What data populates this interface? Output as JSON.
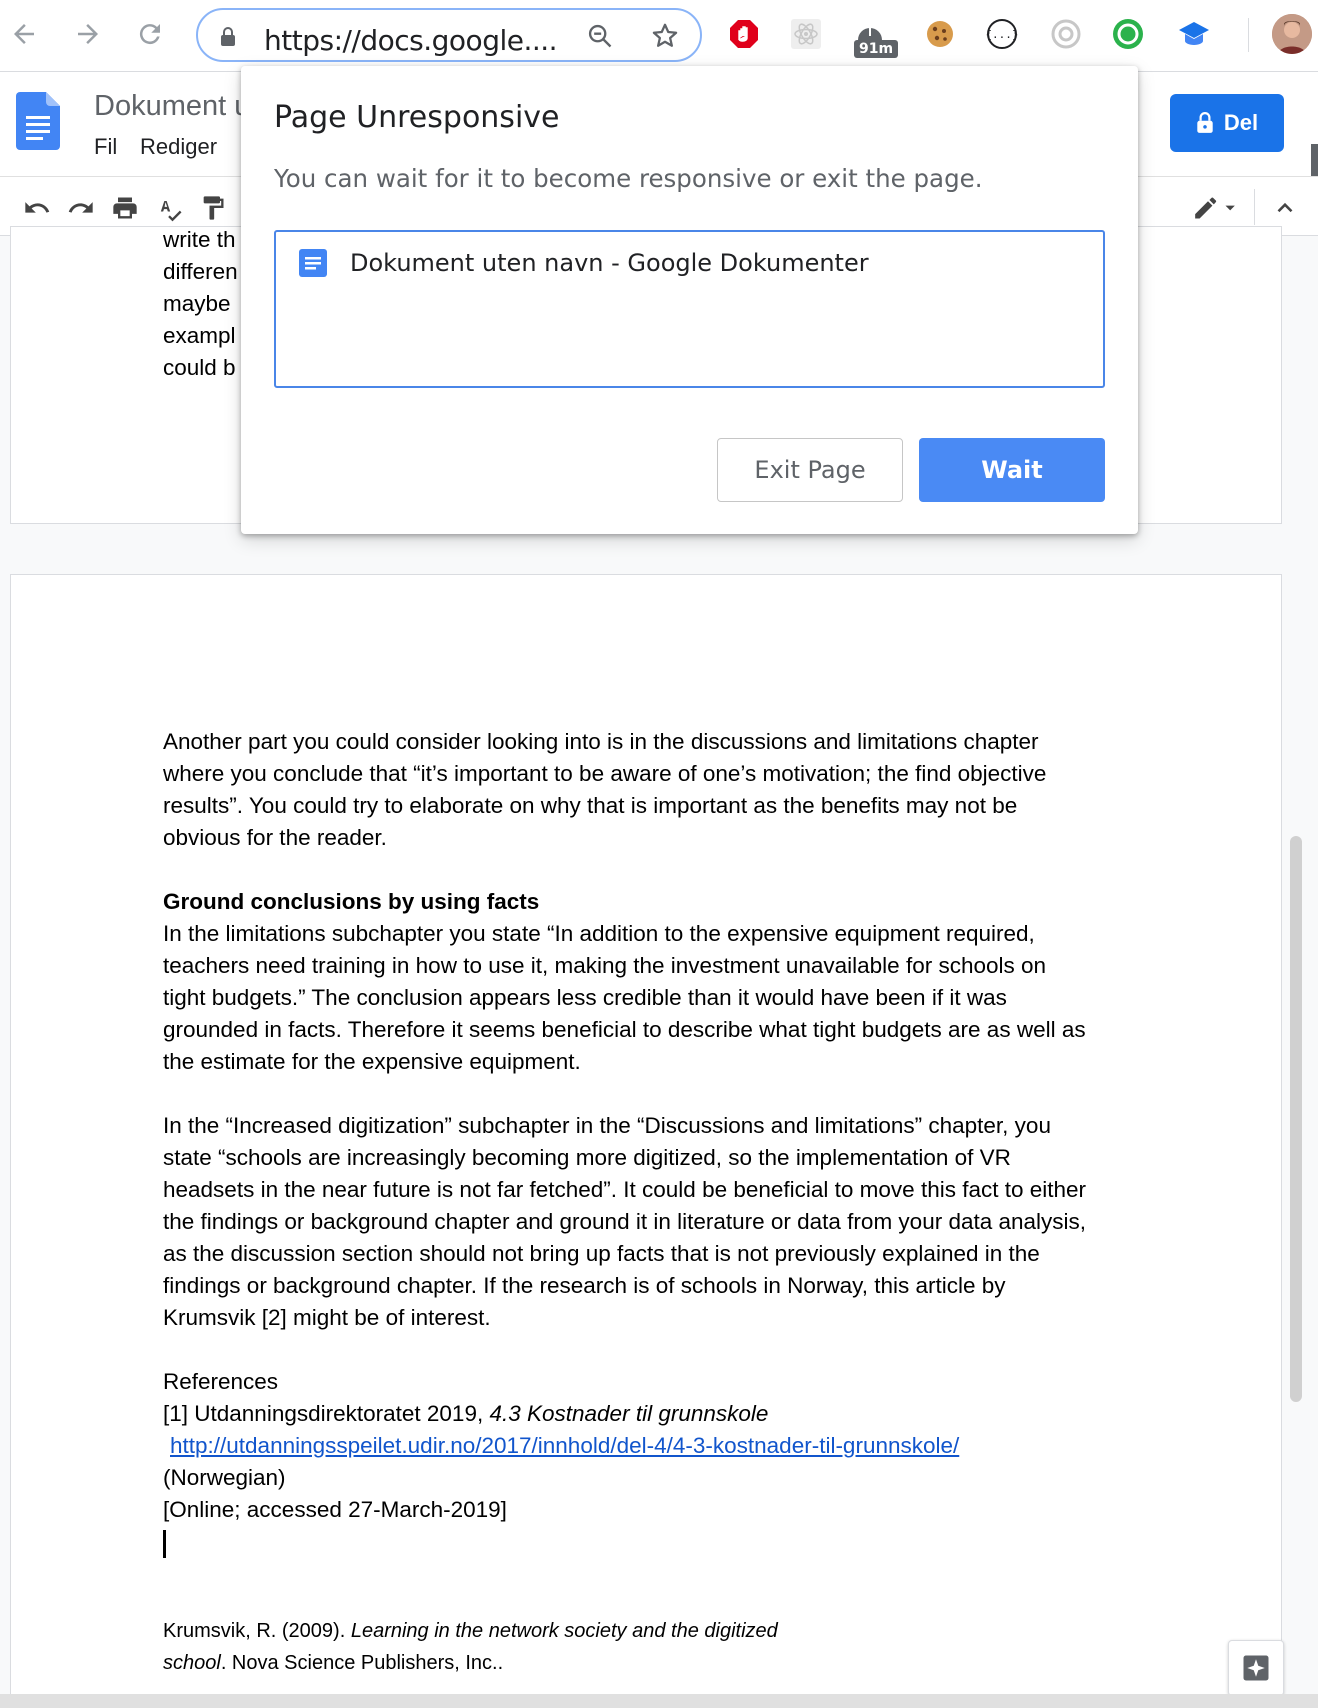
{
  "browser": {
    "url": "https://docs.google....",
    "badge_text": "91m"
  },
  "docs": {
    "title": "Dokument u",
    "menu": [
      "Fil",
      "Rediger"
    ],
    "share_label": "Del"
  },
  "page1_lines": [
    "write th",
    "differen",
    "maybe",
    "exampl",
    "could b"
  ],
  "page2": {
    "para1": [
      "Another part you could consider looking into is in the discussions and limitations chapter",
      "where you conclude that “it’s important to be aware of one’s motivation; the find objective",
      "results”. You could try to elaborate on why that is important as the benefits may not be",
      "obvious for the reader."
    ],
    "heading": "Ground conclusions by using facts",
    "para2": [
      "In the limitations subchapter you state “In addition to the expensive equipment required,",
      "teachers need training in how to use it, making the investment unavailable for schools on",
      "tight budgets.” The conclusion appears less credible than it would have been if it was",
      "grounded in facts. Therefore it seems beneficial to describe what tight budgets are as well as",
      "the estimate for the expensive equipment."
    ],
    "para3": [
      "In the “Increased digitization” subchapter in the “Discussions and limitations” chapter, you",
      "state “schools are increasingly becoming more digitized, so the implementation of VR",
      "headsets in the near future is not far fetched”. It could be beneficial to move this fact to either",
      "the findings or background chapter and ground it in literature or data from your data analysis,",
      "as the discussion section should not bring up facts that is not previously explained in the",
      "findings or background chapter. If the research is of schools in Norway, this article by",
      "Krumsvik [2] might be of interest."
    ],
    "references_heading": "References",
    "ref1_prefix": "[1] Utdanningsdirektoratet 2019, ",
    "ref1_title": "4.3 Kostnader til grunnskole",
    "ref1_link": "http://utdanningsspeilet.udir.no/2017/innhold/del-4/4-3-kostnader-til-grunnskole/",
    "ref1_lang": "(Norwegian)",
    "ref1_accessed": "[Online; accessed 27-March-2019]",
    "ref2_prefix": "Krumsvik, R. (2009). ",
    "ref2_title_a": "Learning in the network society and the digitized",
    "ref2_title_b": "school",
    "ref2_suffix": ". Nova Science Publishers, Inc.."
  },
  "dialog": {
    "title": "Page Unresponsive",
    "message": "You can wait for it to become responsive or exit the page.",
    "tab_title": "Dokument uten navn - Google Dokumenter",
    "exit_label": "Exit Page",
    "wait_label": "Wait"
  },
  "colors": {
    "accent": "#1a73e8",
    "wait_button": "#4a8af4",
    "link": "#1155cc"
  },
  "icons": [
    "back-icon",
    "forward-icon",
    "reload-icon",
    "lock-icon",
    "zoom-icon",
    "star-icon",
    "adblock-icon",
    "react-icon",
    "timer-icon",
    "cookie-icon",
    "json-icon",
    "record-icon",
    "green-ext-icon",
    "graduation-icon",
    "undo-icon",
    "redo-icon",
    "print-icon",
    "spellcheck-icon",
    "paint-format-icon",
    "edit-mode-icon",
    "collapse-icon",
    "explore-icon"
  ]
}
